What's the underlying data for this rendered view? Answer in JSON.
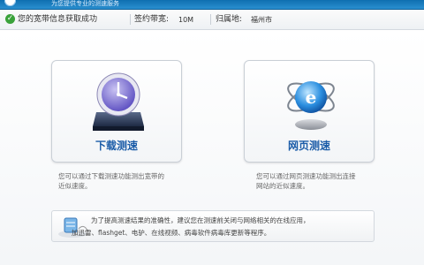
{
  "header": {
    "title": "为您提供专业的测速服务"
  },
  "status": {
    "message": "您的宽带信息获取成功",
    "bandwidth_label": "签约带宽:",
    "bandwidth_value": "10M",
    "location_label": "归属地:",
    "location_value": "福州市"
  },
  "cards": [
    {
      "label": "下载测速",
      "icon": "download-speed-disk-clock-icon",
      "description_line1": "您可以通过下载测速功能测出宽带的",
      "description_line2": "近似速度。"
    },
    {
      "label": "网页测速",
      "icon": "web-speed-globe-icon",
      "description_line1": "您可以通过网页测速功能测出连接",
      "description_line2": "网站的近似速度。"
    }
  ],
  "tip": {
    "line1": "为了提高测速结果的准确性，建议您在测速前关闭与网络相关的在线应用，",
    "line2": "加迅雷、flashget、电驴、在线视频、病毒软件病毒库更新等程序。"
  },
  "colors": {
    "accent": "#1b5ca8",
    "header": "#0f6fb0",
    "success": "#3aa23a"
  }
}
